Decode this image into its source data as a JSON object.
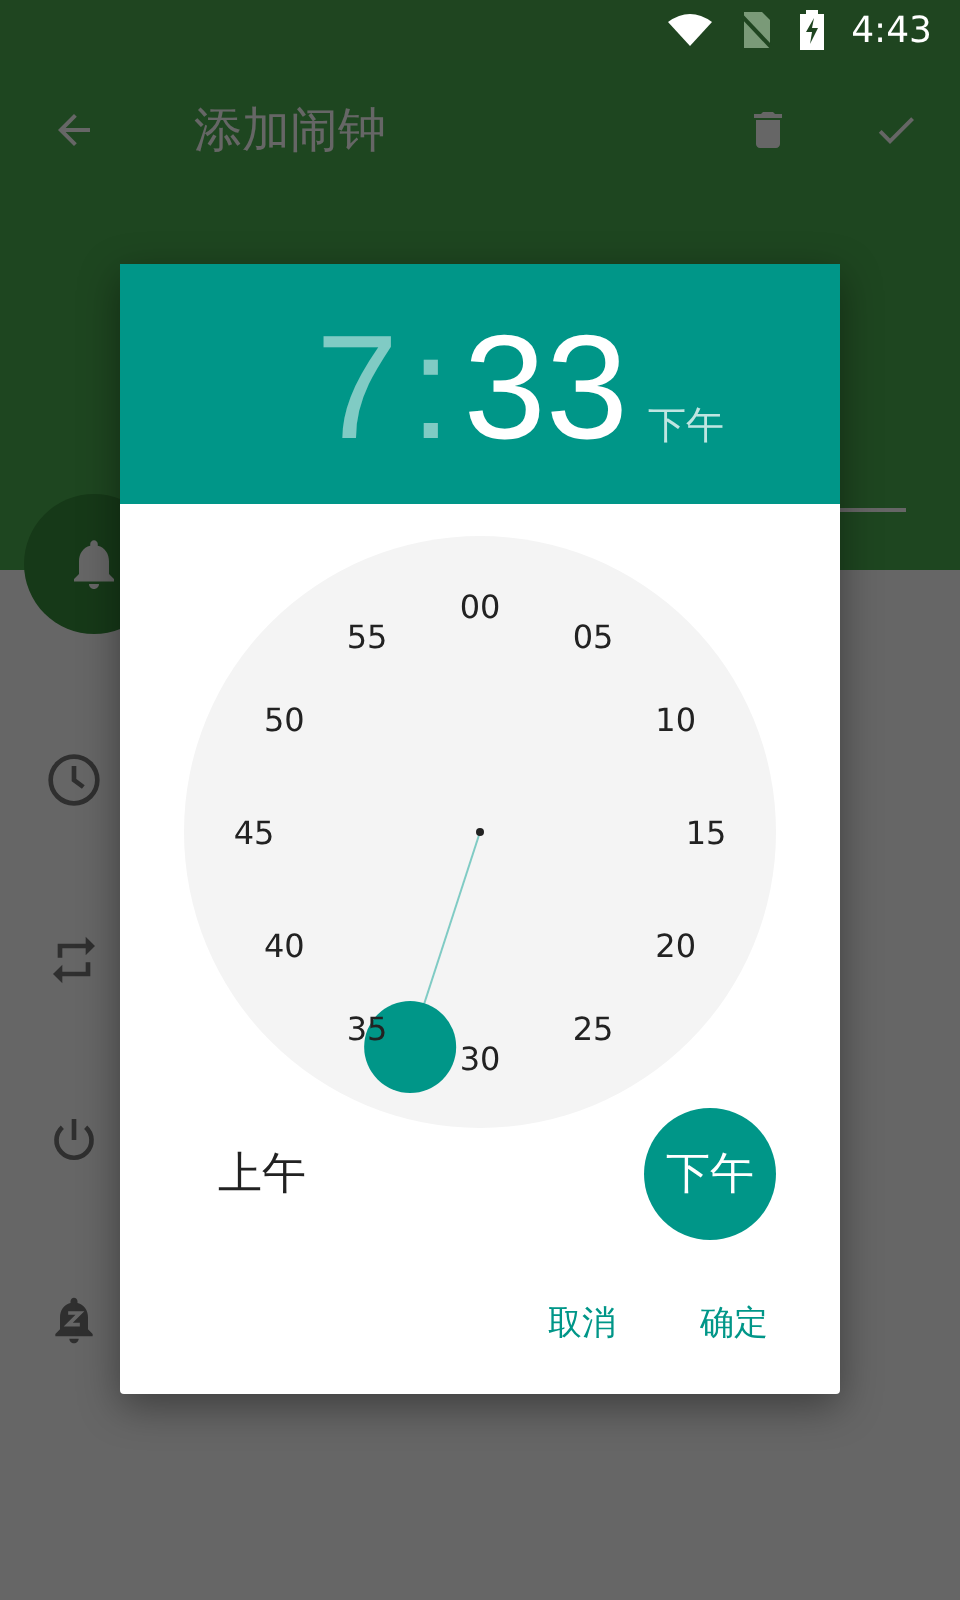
{
  "status_bar": {
    "time": "4:43"
  },
  "toolbar": {
    "title": "添加闹钟"
  },
  "dialog": {
    "hour": "7",
    "separator": ":",
    "minute": "33",
    "hour_selected": false,
    "minute_selected": true,
    "header_period": "下午",
    "dial_numbers": [
      "00",
      "05",
      "10",
      "15",
      "20",
      "25",
      "30",
      "35",
      "40",
      "45",
      "50",
      "55"
    ],
    "periods": [
      {
        "label": "上午",
        "selected": false
      },
      {
        "label": "下午",
        "selected": true
      }
    ],
    "buttons": [
      "取消",
      "确定"
    ]
  }
}
